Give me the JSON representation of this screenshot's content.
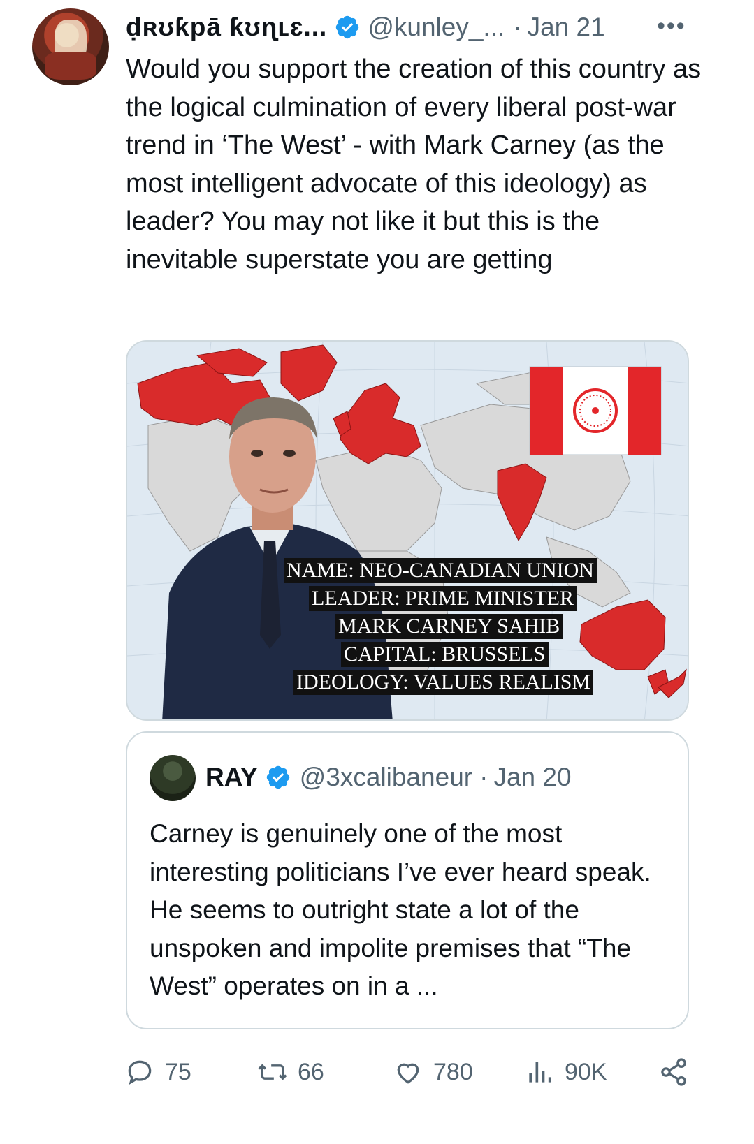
{
  "tweet": {
    "display_name": "ḍʀʊƙpā ƙʊɳʟɛ...",
    "handle": "@kunley_...",
    "separator": "·",
    "date": "Jan 21",
    "more_label": "•••",
    "text": "Would you support the creation of this country as the logical culmination of every liberal post-war trend in ‘The West’ - with Mark Carney (as the most intelligent advocate of this ideology) as leader? You may not like it but this is the inevitable superstate you are getting"
  },
  "media": {
    "caption_lines": [
      "NAME: NEO-CANADIAN UNION",
      "LEADER: PRIME MINISTER",
      "MARK CARNEY SAHIB",
      "CAPITAL: BRUSSELS",
      "IDEOLOGY: VALUES REALISM"
    ],
    "colors": {
      "map_red": "#d92b2b",
      "land_gray": "#d9d9d9",
      "ocean": "#dfe9f2",
      "flag_red": "#e3262a"
    }
  },
  "quote": {
    "display_name": "RAY",
    "handle": "@3xcalibaneur",
    "separator": "·",
    "date": "Jan 20",
    "text": "Carney is genuinely one of the most interesting politicians I’ve ever heard speak. He seems to outright state a lot of the unspoken and impolite premises that “The West” operates on in a ..."
  },
  "actions": {
    "replies": "75",
    "reposts": "66",
    "likes": "780",
    "views": "90K"
  },
  "icons": [
    "verified-badge-icon",
    "more-icon",
    "reply-icon",
    "repost-icon",
    "like-icon",
    "views-icon",
    "share-icon"
  ],
  "accent_color": "#1d9bf0"
}
